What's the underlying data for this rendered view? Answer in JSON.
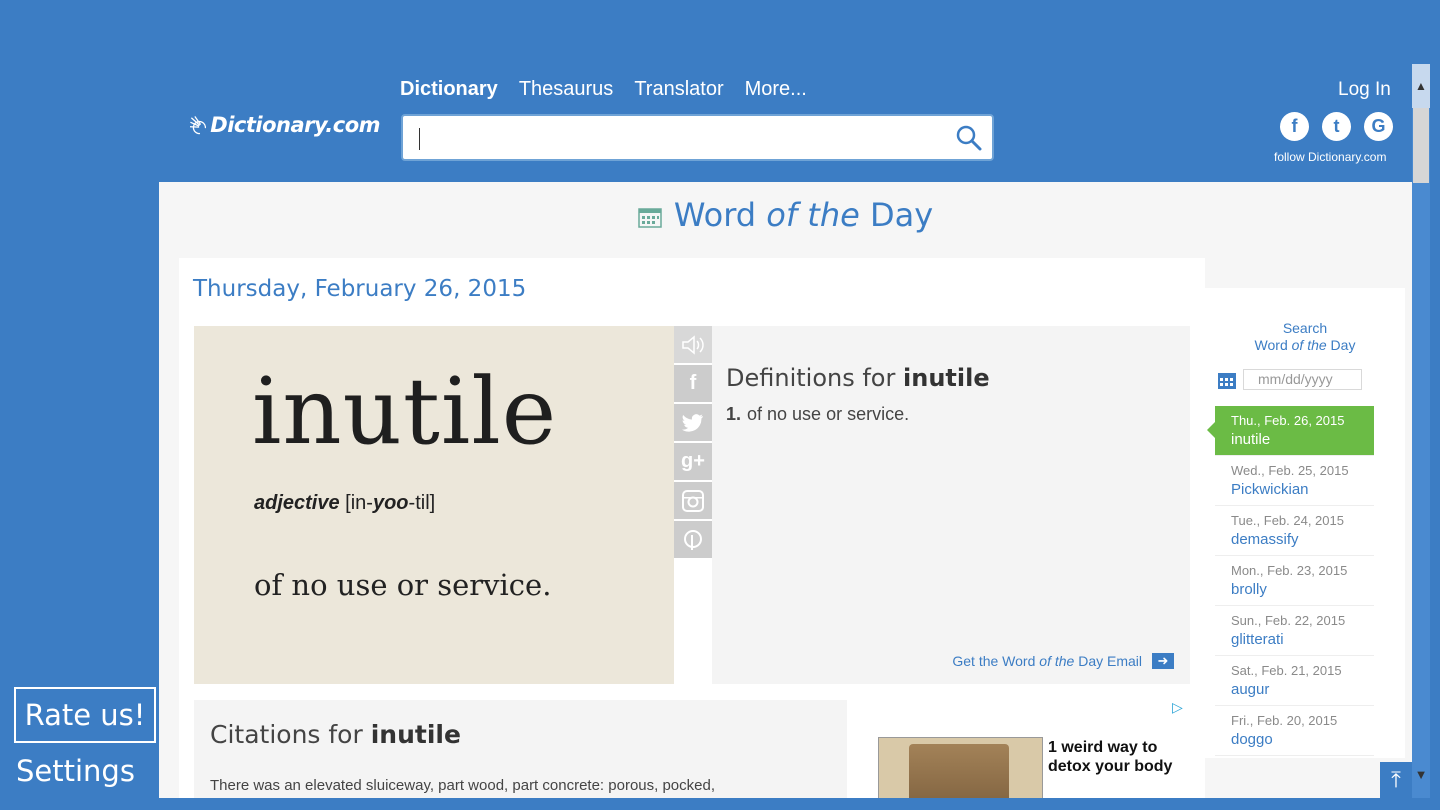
{
  "header": {
    "logo_text": "Dictionary.com",
    "nav": [
      "Dictionary",
      "Thesaurus",
      "Translator",
      "More..."
    ],
    "login": "Log In",
    "follow": "follow Dictionary.com",
    "social": [
      "f",
      "t",
      "G"
    ]
  },
  "page": {
    "title_word": "Word",
    "title_of_the": "of the",
    "title_day": "Day",
    "date_heading": "Thursday, February 26, 2015"
  },
  "word": {
    "text": "inutile",
    "part_of_speech": "adjective",
    "pronunciation_pre": "[in-",
    "pronunciation_stress": "yoo",
    "pronunciation_post": "-til]",
    "image_definition": "of no use or service.",
    "share": [
      "f",
      "g+"
    ]
  },
  "definitions": {
    "title_prefix": "Definitions for",
    "word": "inutile",
    "items": [
      {
        "num": "1.",
        "text": "of no use or service."
      }
    ],
    "email_prefix": "Get the Word",
    "email_mid": "of the",
    "email_suffix": "Day Email"
  },
  "citations": {
    "title_prefix": "Citations for",
    "word": "inutile",
    "text": "There was an elevated sluiceway, part wood, part concrete: porous, pocked,"
  },
  "ad": {
    "text_line1": "1 weird way to",
    "text_line2": "detox your body"
  },
  "sidebar": {
    "search_line1": "Search",
    "search_word": "Word",
    "search_of_the": "of the",
    "search_day": "Day",
    "date_placeholder": "mm/dd/yyyy",
    "history": [
      {
        "date": "Thu., Feb. 26, 2015",
        "word": "inutile"
      },
      {
        "date": "Wed., Feb. 25, 2015",
        "word": "Pickwickian"
      },
      {
        "date": "Tue., Feb. 24, 2015",
        "word": "demassify"
      },
      {
        "date": "Mon., Feb. 23, 2015",
        "word": "brolly"
      },
      {
        "date": "Sun., Feb. 22, 2015",
        "word": "glitterati"
      },
      {
        "date": "Sat., Feb. 21, 2015",
        "word": "augur"
      },
      {
        "date": "Fri., Feb. 20, 2015",
        "word": "doggo"
      }
    ]
  },
  "app": {
    "rate": "Rate us!",
    "settings": "Settings"
  },
  "colors": {
    "brand_blue": "#3c7dc4",
    "active_green": "#6bbb45"
  }
}
